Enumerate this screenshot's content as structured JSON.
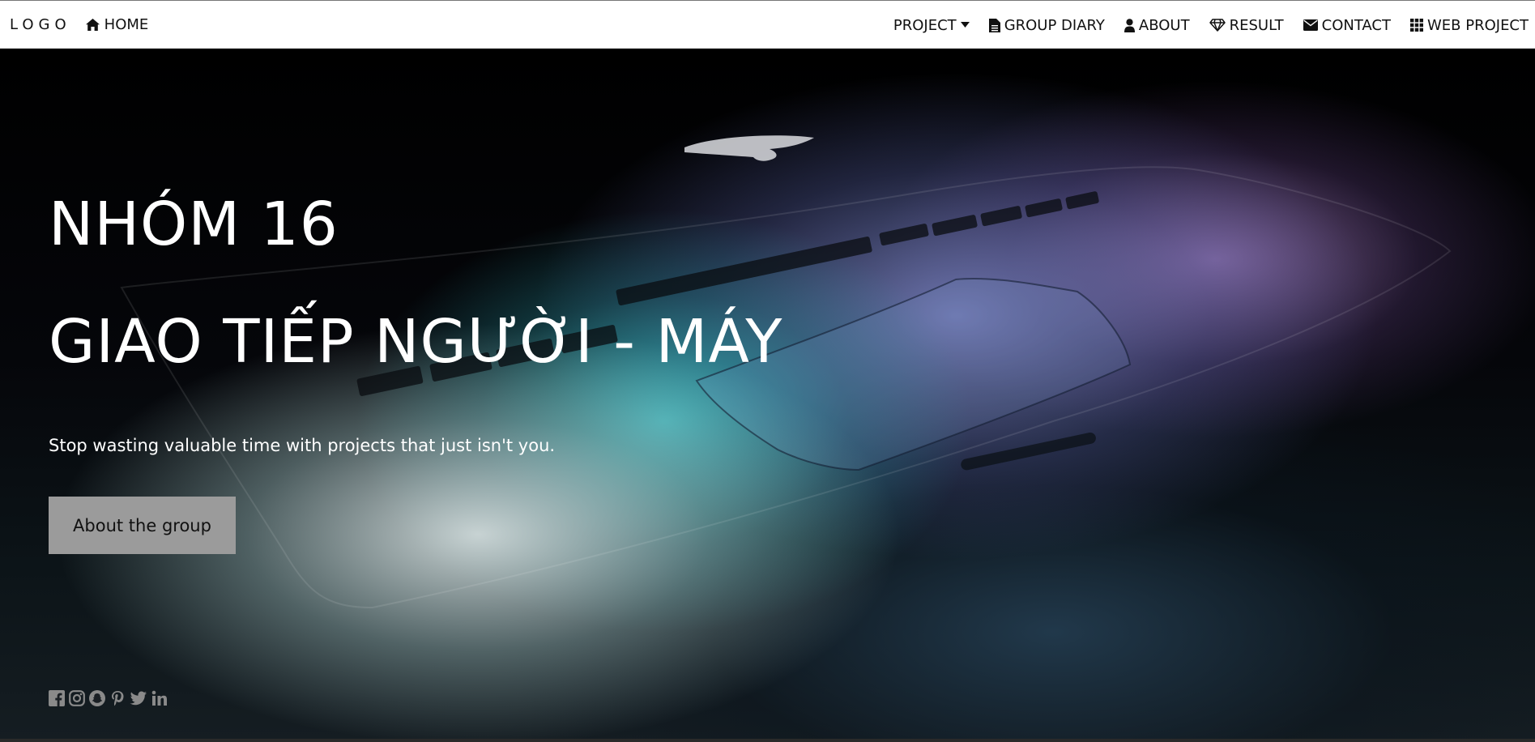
{
  "header": {
    "logo": "LOGO",
    "home": {
      "label": "HOME",
      "icon": "home-icon"
    },
    "nav": [
      {
        "label": "PROJECT",
        "icon": "caret-down-icon"
      },
      {
        "label": "GROUP DIARY",
        "icon": "file-icon"
      },
      {
        "label": "ABOUT",
        "icon": "user-icon"
      },
      {
        "label": "RESULT",
        "icon": "diamond-icon"
      },
      {
        "label": "CONTACT",
        "icon": "envelope-icon"
      },
      {
        "label": "WEB PROJECT",
        "icon": "grid-icon"
      }
    ]
  },
  "hero": {
    "title": "NHÓM 16",
    "subtitle": "GIAO TIẾP NGƯỜI - MÁY",
    "tagline": "Stop wasting valuable time with projects that just isn't you.",
    "button_label": "About the group",
    "background": "laptop-keyboard-photo"
  },
  "social": [
    "facebook-icon",
    "instagram-icon",
    "snapchat-icon",
    "pinterest-icon",
    "twitter-icon",
    "linkedin-icon"
  ],
  "colors": {
    "topbar_bg": "#ffffff",
    "text_dark": "#111111",
    "hero_text": "#ffffff",
    "button_bg": "#9b9b9b",
    "social_icon": "#8a8a8a"
  }
}
